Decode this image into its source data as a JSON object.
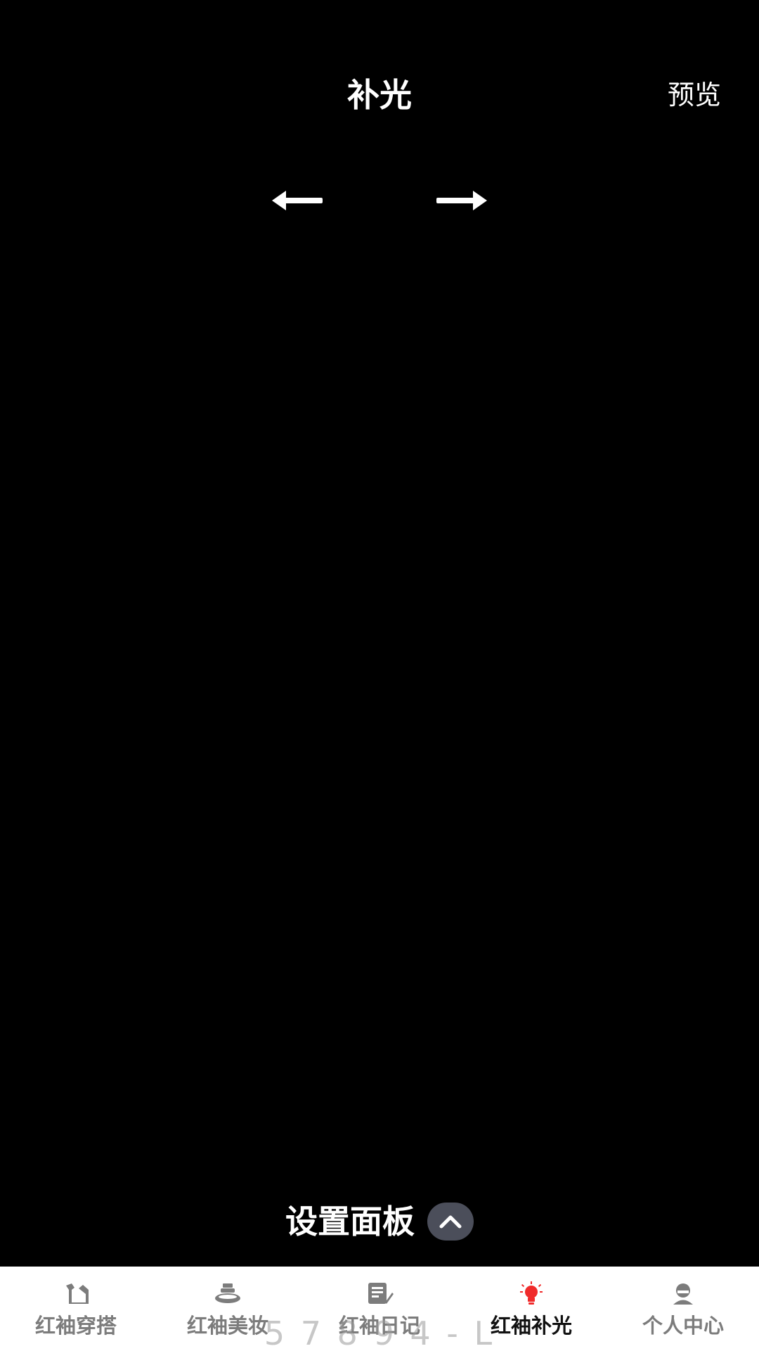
{
  "header": {
    "title": "补光",
    "preview_label": "预览"
  },
  "navigation_arrows": {
    "left_icon": "arrow-left-icon",
    "right_icon": "arrow-right-icon"
  },
  "settings_panel": {
    "label": "设置面板",
    "toggle_icon": "chevron-up-icon"
  },
  "bottom_nav": {
    "items": [
      {
        "label": "红袖穿搭",
        "icon": "outfit-icon",
        "active": false
      },
      {
        "label": "红袖美妆",
        "icon": "makeup-icon",
        "active": false
      },
      {
        "label": "红袖日记",
        "icon": "diary-icon",
        "active": false
      },
      {
        "label": "红袖补光",
        "icon": "bulb-icon",
        "active": true
      },
      {
        "label": "个人中心",
        "icon": "profile-icon",
        "active": false
      }
    ]
  },
  "overlay_watermark": "5 7 8 9 4 - L",
  "colors": {
    "background": "#000000",
    "nav_background": "#ffffff",
    "active_icon": "#f02b2b",
    "inactive": "#7c7c7c",
    "toggle_bg": "#4b4e5a"
  }
}
